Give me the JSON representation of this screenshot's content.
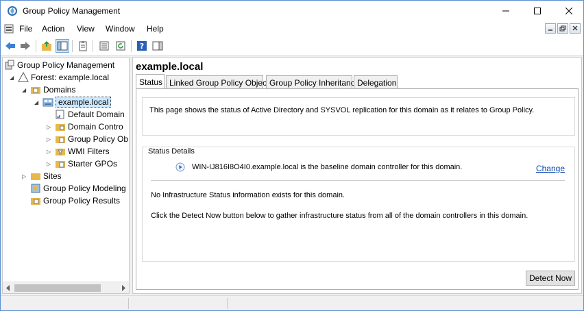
{
  "window": {
    "title": "Group Policy Management",
    "icon": "gpmc-icon"
  },
  "menubar": {
    "items": [
      "File",
      "Action",
      "View",
      "Window",
      "Help"
    ]
  },
  "toolbar": {
    "icons": [
      "back-icon",
      "forward-icon",
      "up-folder-icon",
      "show-hide-tree-icon",
      "properties-icon",
      "export-list-icon",
      "refresh-icon",
      "help-icon",
      "show-action-pane-icon"
    ]
  },
  "tree": {
    "items": [
      {
        "label": "Group Policy Management",
        "icon": "gpmc-icon",
        "expander": "",
        "depth": 0
      },
      {
        "label": "Forest: example.local",
        "icon": "forest-icon",
        "expander": "expanded",
        "depth": 1
      },
      {
        "label": "Domains",
        "icon": "domains-folder-icon",
        "expander": "expanded",
        "depth": 2
      },
      {
        "label": "example.local",
        "icon": "domain-icon",
        "expander": "expanded",
        "depth": 3,
        "selected": true
      },
      {
        "label": "Default Domain",
        "icon": "gpo-link-icon",
        "expander": "",
        "depth": 4
      },
      {
        "label": "Domain Contro",
        "icon": "ou-folder-icon",
        "expander": "collapsed",
        "depth": 4
      },
      {
        "label": "Group Policy Ob",
        "icon": "gpo-folder-icon",
        "expander": "collapsed",
        "depth": 4
      },
      {
        "label": "WMI Filters",
        "icon": "wmi-folder-icon",
        "expander": "collapsed",
        "depth": 4
      },
      {
        "label": "Starter GPOs",
        "icon": "starter-gpo-folder-icon",
        "expander": "collapsed",
        "depth": 4
      },
      {
        "label": "Sites",
        "icon": "sites-folder-icon",
        "expander": "collapsed",
        "depth": 2
      },
      {
        "label": "Group Policy Modeling",
        "icon": "gp-modeling-icon",
        "expander": "",
        "depth": 2
      },
      {
        "label": "Group Policy Results",
        "icon": "gp-results-icon",
        "expander": "",
        "depth": 2
      }
    ]
  },
  "main": {
    "title": "example.local",
    "tabs": [
      {
        "label": "Status",
        "active": true
      },
      {
        "label": "Linked Group Policy Objects",
        "active": false
      },
      {
        "label": "Group Policy Inheritance",
        "active": false
      },
      {
        "label": "Delegation",
        "active": false
      }
    ],
    "info_text": "This page shows the status of Active Directory and SYSVOL replication for this domain as it relates to Group Policy.",
    "status_details_label": "Status Details",
    "baseline_text": "WIN-IJ816I8O4I0.example.local is the baseline domain controller for this domain.",
    "change_link": "Change",
    "no_info_text": "No Infrastructure Status information exists for this domain.",
    "detect_hint": "Click the Detect Now button below to gather infrastructure status from all of the domain controllers in this domain.",
    "detect_button": "Detect Now"
  },
  "colors": {
    "accent": "#0645ad",
    "selection": "#cce8ff",
    "window_border": "#5a8fd0"
  }
}
